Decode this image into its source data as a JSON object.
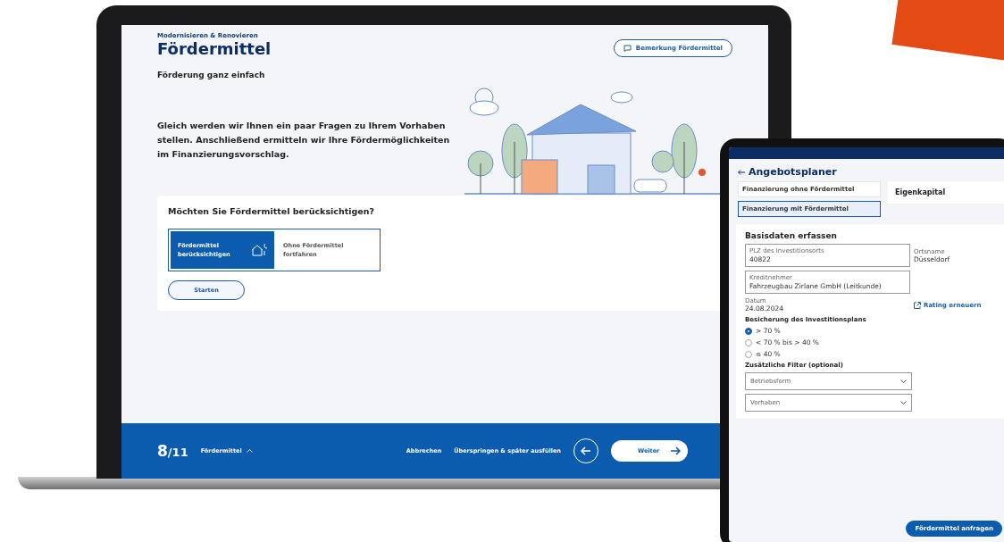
{
  "laptop": {
    "breadcrumb": "Modernisieren & Renovieren",
    "title": "Fördermittel",
    "remark_button": "Bemerkung Fördermittel",
    "subtitle": "Förderung ganz einfach",
    "intro": "Gleich werden wir Ihnen ein paar Fragen zu Ihrem Vorhaben stellen. Anschließend ermitteln wir Ihre Fördermöglichkeiten im Finanzierungsvorschlag.",
    "question": "Möchten Sie Fördermittel berücksichtigen?",
    "options": [
      {
        "label": "Fördermittel berücksichtigen",
        "selected": true
      },
      {
        "label": "Ohne Fördermittel fortfahren",
        "selected": false
      }
    ],
    "start_button": "Starten",
    "footer": {
      "step": "8",
      "total": "/11",
      "section": "Fördermittel",
      "cancel": "Abbrechen",
      "skip": "Überspringen & später ausfüllen",
      "next": "Weiter"
    }
  },
  "tablet": {
    "title": "Angebotsplaner",
    "variants": [
      {
        "label": "Finanzierung ohne Fördermittel",
        "selected": false
      },
      {
        "label": "Finanzierung mit Fördermittel",
        "selected": true
      }
    ],
    "equity": "Eigenkapital",
    "section": "Basisdaten erfassen",
    "fields": [
      {
        "label": "PLZ des Investitionsorts",
        "value": "40822"
      },
      {
        "label": "Kreditnehmer",
        "value": "Fahrzeugbau Zirlane GmbH (Leitkunde)"
      }
    ],
    "city_label": "Ortsname",
    "city": "Düsseldorf",
    "date_label": "Datum",
    "date": "24.08.2024",
    "rating_link": "Rating erneuern",
    "collateral_title": "Besicherung des Investitionsplans",
    "collateral": [
      {
        "label": "> 70 %",
        "selected": true
      },
      {
        "label": "< 70 % bis > 40 %",
        "selected": false
      },
      {
        "label": "≤ 40 %",
        "selected": false
      }
    ],
    "filter_title": "Zusätzliche Filter (optional)",
    "filters": [
      {
        "placeholder": "Betriebsform"
      },
      {
        "placeholder": "Vorhaben"
      }
    ],
    "submit": "Fördermittel anfragen"
  }
}
